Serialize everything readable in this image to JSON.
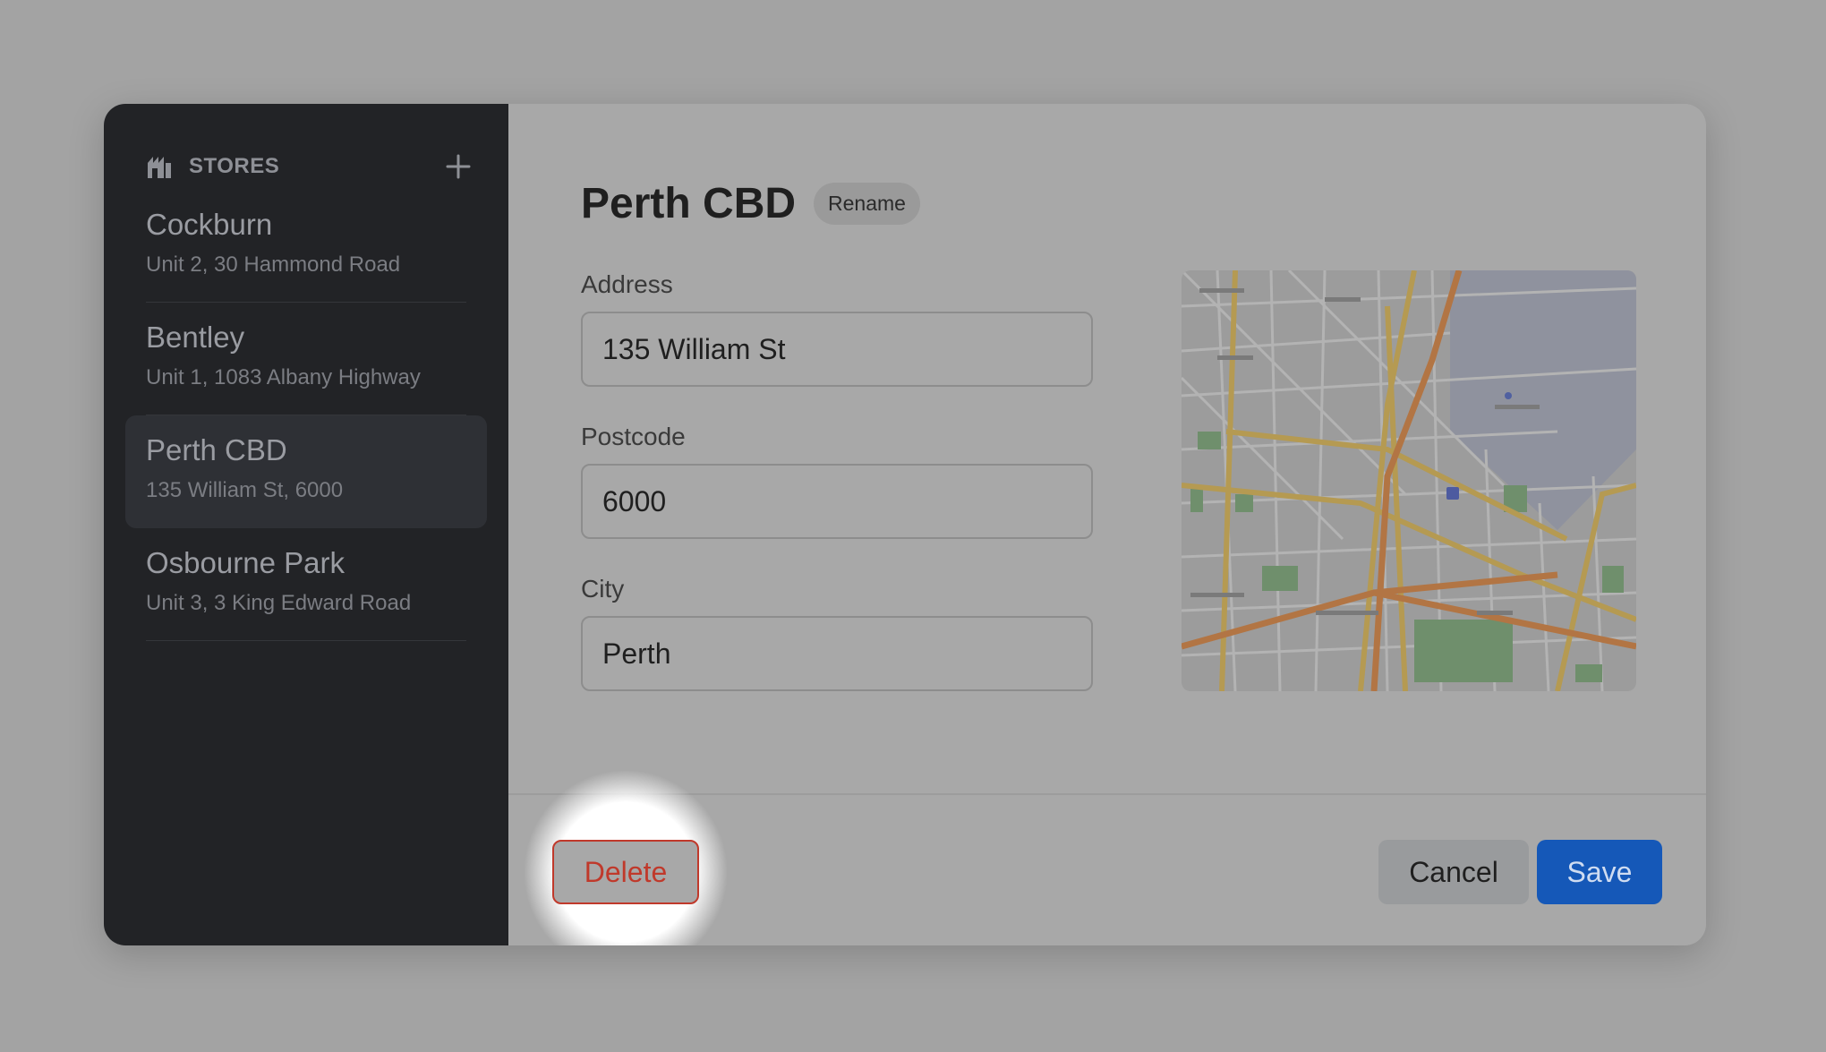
{
  "sidebar": {
    "title": "STORES",
    "store_icon": "store-icon",
    "add_icon": "plus-icon",
    "stores": [
      {
        "name": "Cockburn",
        "address": "Unit 2, 30 Hammond Road",
        "active": false
      },
      {
        "name": "Bentley",
        "address": "Unit 1, 1083 Albany Highway",
        "active": false
      },
      {
        "name": "Perth CBD",
        "address": "135 William St, 6000",
        "active": true
      },
      {
        "name": "Osbourne Park",
        "address": "Unit 3, 3 King Edward Road",
        "active": false
      }
    ]
  },
  "main": {
    "title": "Perth CBD",
    "rename_label": "Rename",
    "address": {
      "label": "Address",
      "value": "135 William St"
    },
    "postcode": {
      "label": "Postcode",
      "value": "6000"
    },
    "city": {
      "label": "City",
      "value": "Perth"
    },
    "map": {
      "icon": "map-thumbnail"
    }
  },
  "footer": {
    "delete_label": "Delete",
    "cancel_label": "Cancel",
    "save_label": "Save"
  },
  "colors": {
    "overlay": "#a3a3a3",
    "sidebar_bg": "#222326",
    "danger": "#c0392b",
    "primary": "#1558b8"
  }
}
